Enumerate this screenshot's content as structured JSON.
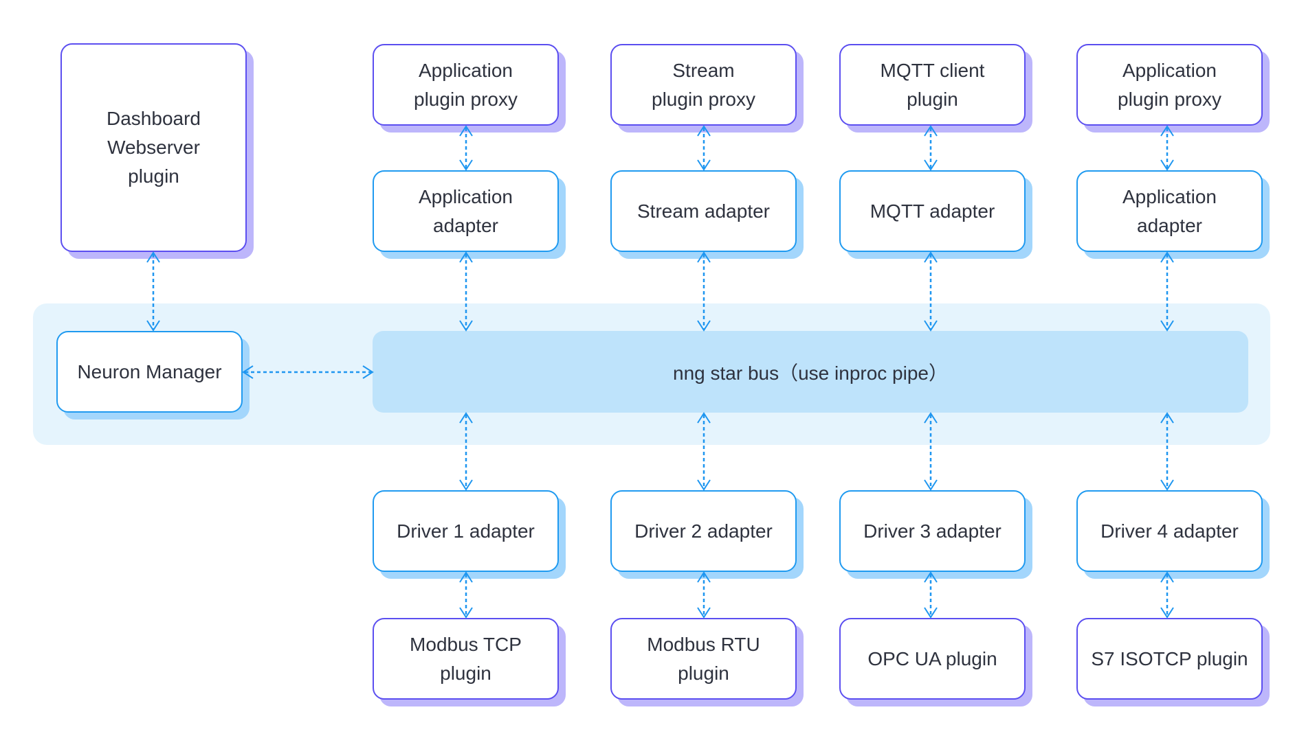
{
  "colors": {
    "plugin_border": "#5b4ef0",
    "plugin_shadow": "#bdb6fb",
    "adapter_border": "#1f9af0",
    "adapter_shadow": "#a3d6fc",
    "band_bg": "#e5f4fd",
    "bus_bg": "#bee3fb",
    "arrow": "#1e96f0",
    "text": "#2e323e"
  },
  "dashboard": {
    "label": "Dashboard\nWebserver\nplugin"
  },
  "manager": {
    "label": "Neuron Manager"
  },
  "bus": {
    "label": "nng star bus（use inproc pipe）"
  },
  "north_plugins": [
    {
      "label": "Application\nplugin proxy"
    },
    {
      "label": "Stream\nplugin proxy"
    },
    {
      "label": "MQTT client\nplugin"
    },
    {
      "label": "Application\nplugin proxy"
    }
  ],
  "north_adapters": [
    {
      "label": "Application\nadapter"
    },
    {
      "label": "Stream adapter"
    },
    {
      "label": "MQTT adapter"
    },
    {
      "label": "Application\nadapter"
    }
  ],
  "south_adapters": [
    {
      "label": "Driver 1 adapter"
    },
    {
      "label": "Driver 2 adapter"
    },
    {
      "label": "Driver 3 adapter"
    },
    {
      "label": "Driver 4 adapter"
    }
  ],
  "south_plugins": [
    {
      "label": "Modbus TCP\nplugin"
    },
    {
      "label": "Modbus RTU\nplugin"
    },
    {
      "label": "OPC UA plugin"
    },
    {
      "label": "S7 ISOTCP plugin"
    }
  ],
  "connections": [
    {
      "from": "dashboard",
      "to": "manager",
      "style": "dashed-bidirectional"
    },
    {
      "from": "manager",
      "to": "bus",
      "style": "dashed-bidirectional"
    },
    {
      "from": "north_plugins",
      "to": "north_adapters",
      "style": "dashed-bidirectional"
    },
    {
      "from": "north_adapters",
      "to": "bus",
      "style": "dashed-bidirectional"
    },
    {
      "from": "bus",
      "to": "south_adapters",
      "style": "dashed-bidirectional"
    },
    {
      "from": "south_adapters",
      "to": "south_plugins",
      "style": "dashed-bidirectional"
    }
  ]
}
